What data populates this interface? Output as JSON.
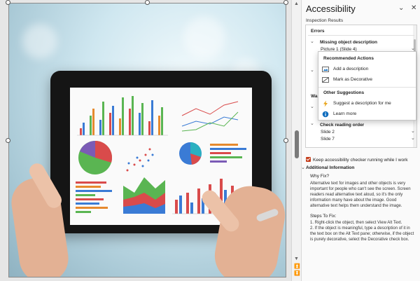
{
  "pane": {
    "title": "Accessibility",
    "dropdown_glyph": "⌄",
    "close_glyph": "✕",
    "inspection_label": "Inspection Results"
  },
  "results": {
    "errors_heading": "Errors",
    "missing_alt": "Missing object description",
    "picture_item": "Picture 1  (Slide 4)",
    "warnings_partial": "Wa",
    "reading_order": "Check reading order",
    "slide_2": "Slide 2",
    "slide_7": "Slide 7"
  },
  "flyout": {
    "recommended_heading": "Recommended Actions",
    "add_description": "Add a description",
    "mark_decorative": "Mark as Decorative",
    "other_heading": "Other Suggestions",
    "suggest_description": "Suggest a description for me",
    "learn_more": "Learn more"
  },
  "footer": {
    "keep_running": "Keep accessibility checker running while I work",
    "keep_running_checked": true,
    "additional_info": "Additional Information",
    "why_fix": "Why Fix?",
    "why_text": "Alternative text for images and other objects is very important for people who can't see the screen. Screen readers read alternative text aloud, so it's the only information many have about the image. Good alternative text helps them understand the image.",
    "steps_heading": "Steps To Fix:",
    "step_1": "1. Right-click the object, then select View Alt Text.",
    "step_2": "2. If the object is meaningful, type a description of it in the text box on the Alt Text pane; otherwise, if the object is purely decorative, select the Decorative check box."
  },
  "colors": {
    "accent": "#c43e1c",
    "pane_bg": "#fafafa",
    "info_blue": "#0f6cbd"
  },
  "icons": [
    "chevron-down-icon",
    "close-icon",
    "alt-text-icon",
    "decorative-icon",
    "lightning-icon",
    "info-icon"
  ]
}
